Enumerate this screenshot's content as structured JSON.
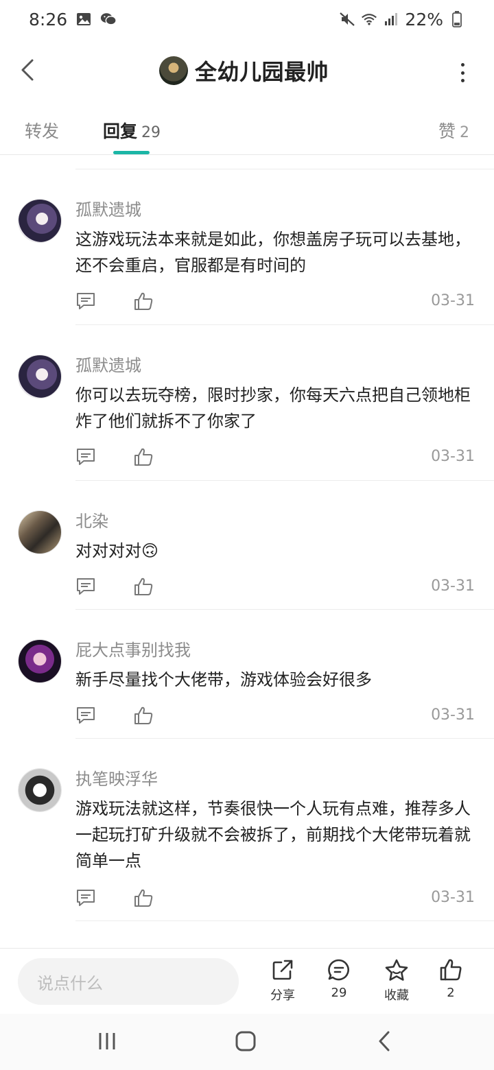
{
  "status_bar": {
    "time": "8:26",
    "battery": "22%"
  },
  "header": {
    "title": "全幼儿园最帅"
  },
  "tabs": {
    "forward_label": "转发",
    "reply_label": "回复",
    "reply_count": "29",
    "like_label": "赞",
    "like_count": "2"
  },
  "comments": [
    {
      "username": "孤默遗城",
      "text": "这游戏玩法本来就是如此，你想盖房子玩可以去基地，还不会重启，官服都是有时间的",
      "date": "03-31"
    },
    {
      "username": "孤默遗城",
      "text": "你可以去玩夺榜，限时抄家，你每天六点把自己领地柜炸了他们就拆不了你家了",
      "date": "03-31"
    },
    {
      "username": "北染",
      "text": "对对对对🙃",
      "date": "03-31"
    },
    {
      "username": "屁大点事别找我",
      "text": "新手尽量找个大佬带，游戏体验会好很多",
      "date": "03-31"
    },
    {
      "username": "执笔映浮华",
      "text": "游戏玩法就这样，节奏很快一个人玩有点难，推荐多人一起玩打矿升级就不会被拆了，前期找个大佬带玩着就简单一点",
      "date": "03-31"
    }
  ],
  "bottom_bar": {
    "input_placeholder": "说点什么",
    "share_label": "分享",
    "comment_count": "29",
    "favorite_label": "收藏",
    "like_count": "2"
  },
  "colors": {
    "accent": "#1bb6a6",
    "muted_text": "#8c8c8c",
    "primary_text": "#222222"
  }
}
